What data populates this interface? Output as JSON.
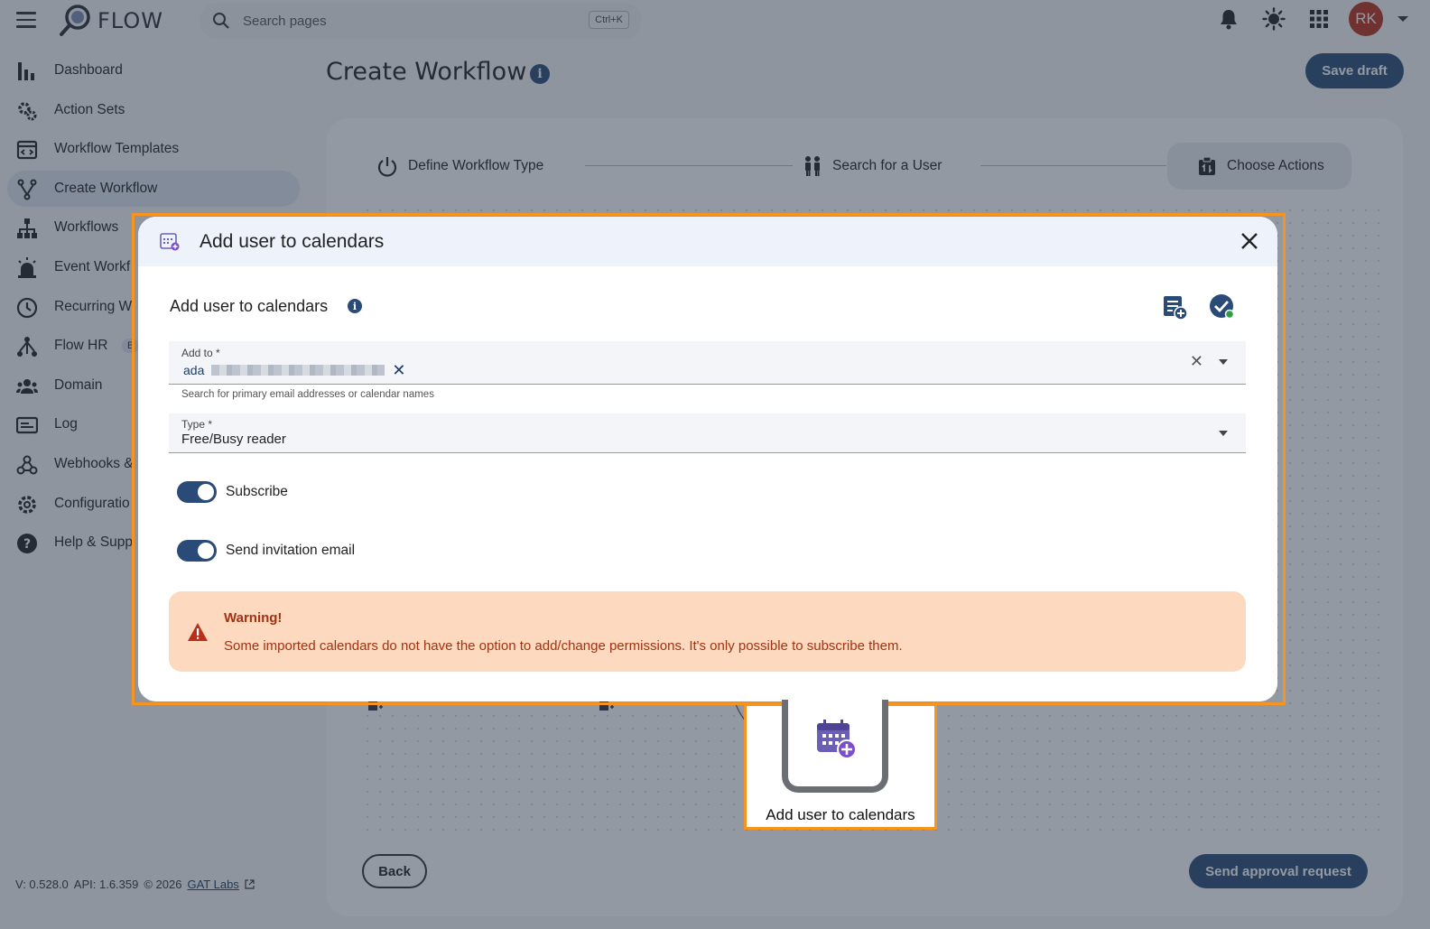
{
  "app": {
    "name": "FLOW"
  },
  "search": {
    "placeholder": "Search pages",
    "shortcut": "Ctrl+K"
  },
  "user": {
    "initials": "RK"
  },
  "colors": {
    "accent": "#2a4a77",
    "avatar": "#b8301a",
    "highlight": "#f7941d",
    "warning_bg": "#fdd9bf",
    "warning_text": "#a13312"
  },
  "sidebar": {
    "items": [
      {
        "label": "Dashboard",
        "icon": "bar-chart-icon"
      },
      {
        "label": "Action Sets",
        "icon": "gears-icon"
      },
      {
        "label": "Workflow Templates",
        "icon": "template-icon"
      },
      {
        "label": "Create Workflow",
        "icon": "fork-icon",
        "active": true
      },
      {
        "label": "Workflows",
        "icon": "hierarchy-icon"
      },
      {
        "label": "Event Workf",
        "icon": "alarm-icon"
      },
      {
        "label": "Recurring W",
        "icon": "clock-icon"
      },
      {
        "label": "Flow HR",
        "icon": "org-icon",
        "badge": "B"
      },
      {
        "label": "Domain",
        "icon": "people-icon"
      },
      {
        "label": "Log",
        "icon": "log-icon"
      },
      {
        "label": "Webhooks &",
        "icon": "webhook-icon"
      },
      {
        "label": "Configuratio",
        "icon": "gear-icon"
      },
      {
        "label": "Help & Supp",
        "icon": "help-icon"
      }
    ]
  },
  "footer": {
    "version": "V: 0.528.0",
    "api": "API: 1.6.359",
    "copyright": "© 2026",
    "link": "GAT Labs"
  },
  "page": {
    "title": "Create Workflow",
    "save_draft": "Save draft",
    "back": "Back",
    "send_approval": "Send approval request"
  },
  "steps": [
    {
      "label": "Define Workflow Type",
      "icon": "power-icon"
    },
    {
      "label": "Search for a User",
      "icon": "users-icon"
    },
    {
      "label": "Choose Actions",
      "icon": "actions-icon"
    }
  ],
  "canvas": {
    "node_label": "Add user to calendars"
  },
  "modal": {
    "title": "Add user to calendars",
    "subtitle": "Add user to calendars",
    "add_to": {
      "label": "Add to *",
      "chip": "ada",
      "helper": "Search for primary email addresses or calendar names"
    },
    "type": {
      "label": "Type *",
      "value": "Free/Busy reader"
    },
    "subscribe": {
      "label": "Subscribe",
      "on": true
    },
    "send_invitation": {
      "label": "Send invitation email",
      "on": true
    },
    "warning": {
      "title": "Warning!",
      "message": "Some imported calendars do not have the option to add/change permissions. It's only possible to subscribe them."
    }
  }
}
